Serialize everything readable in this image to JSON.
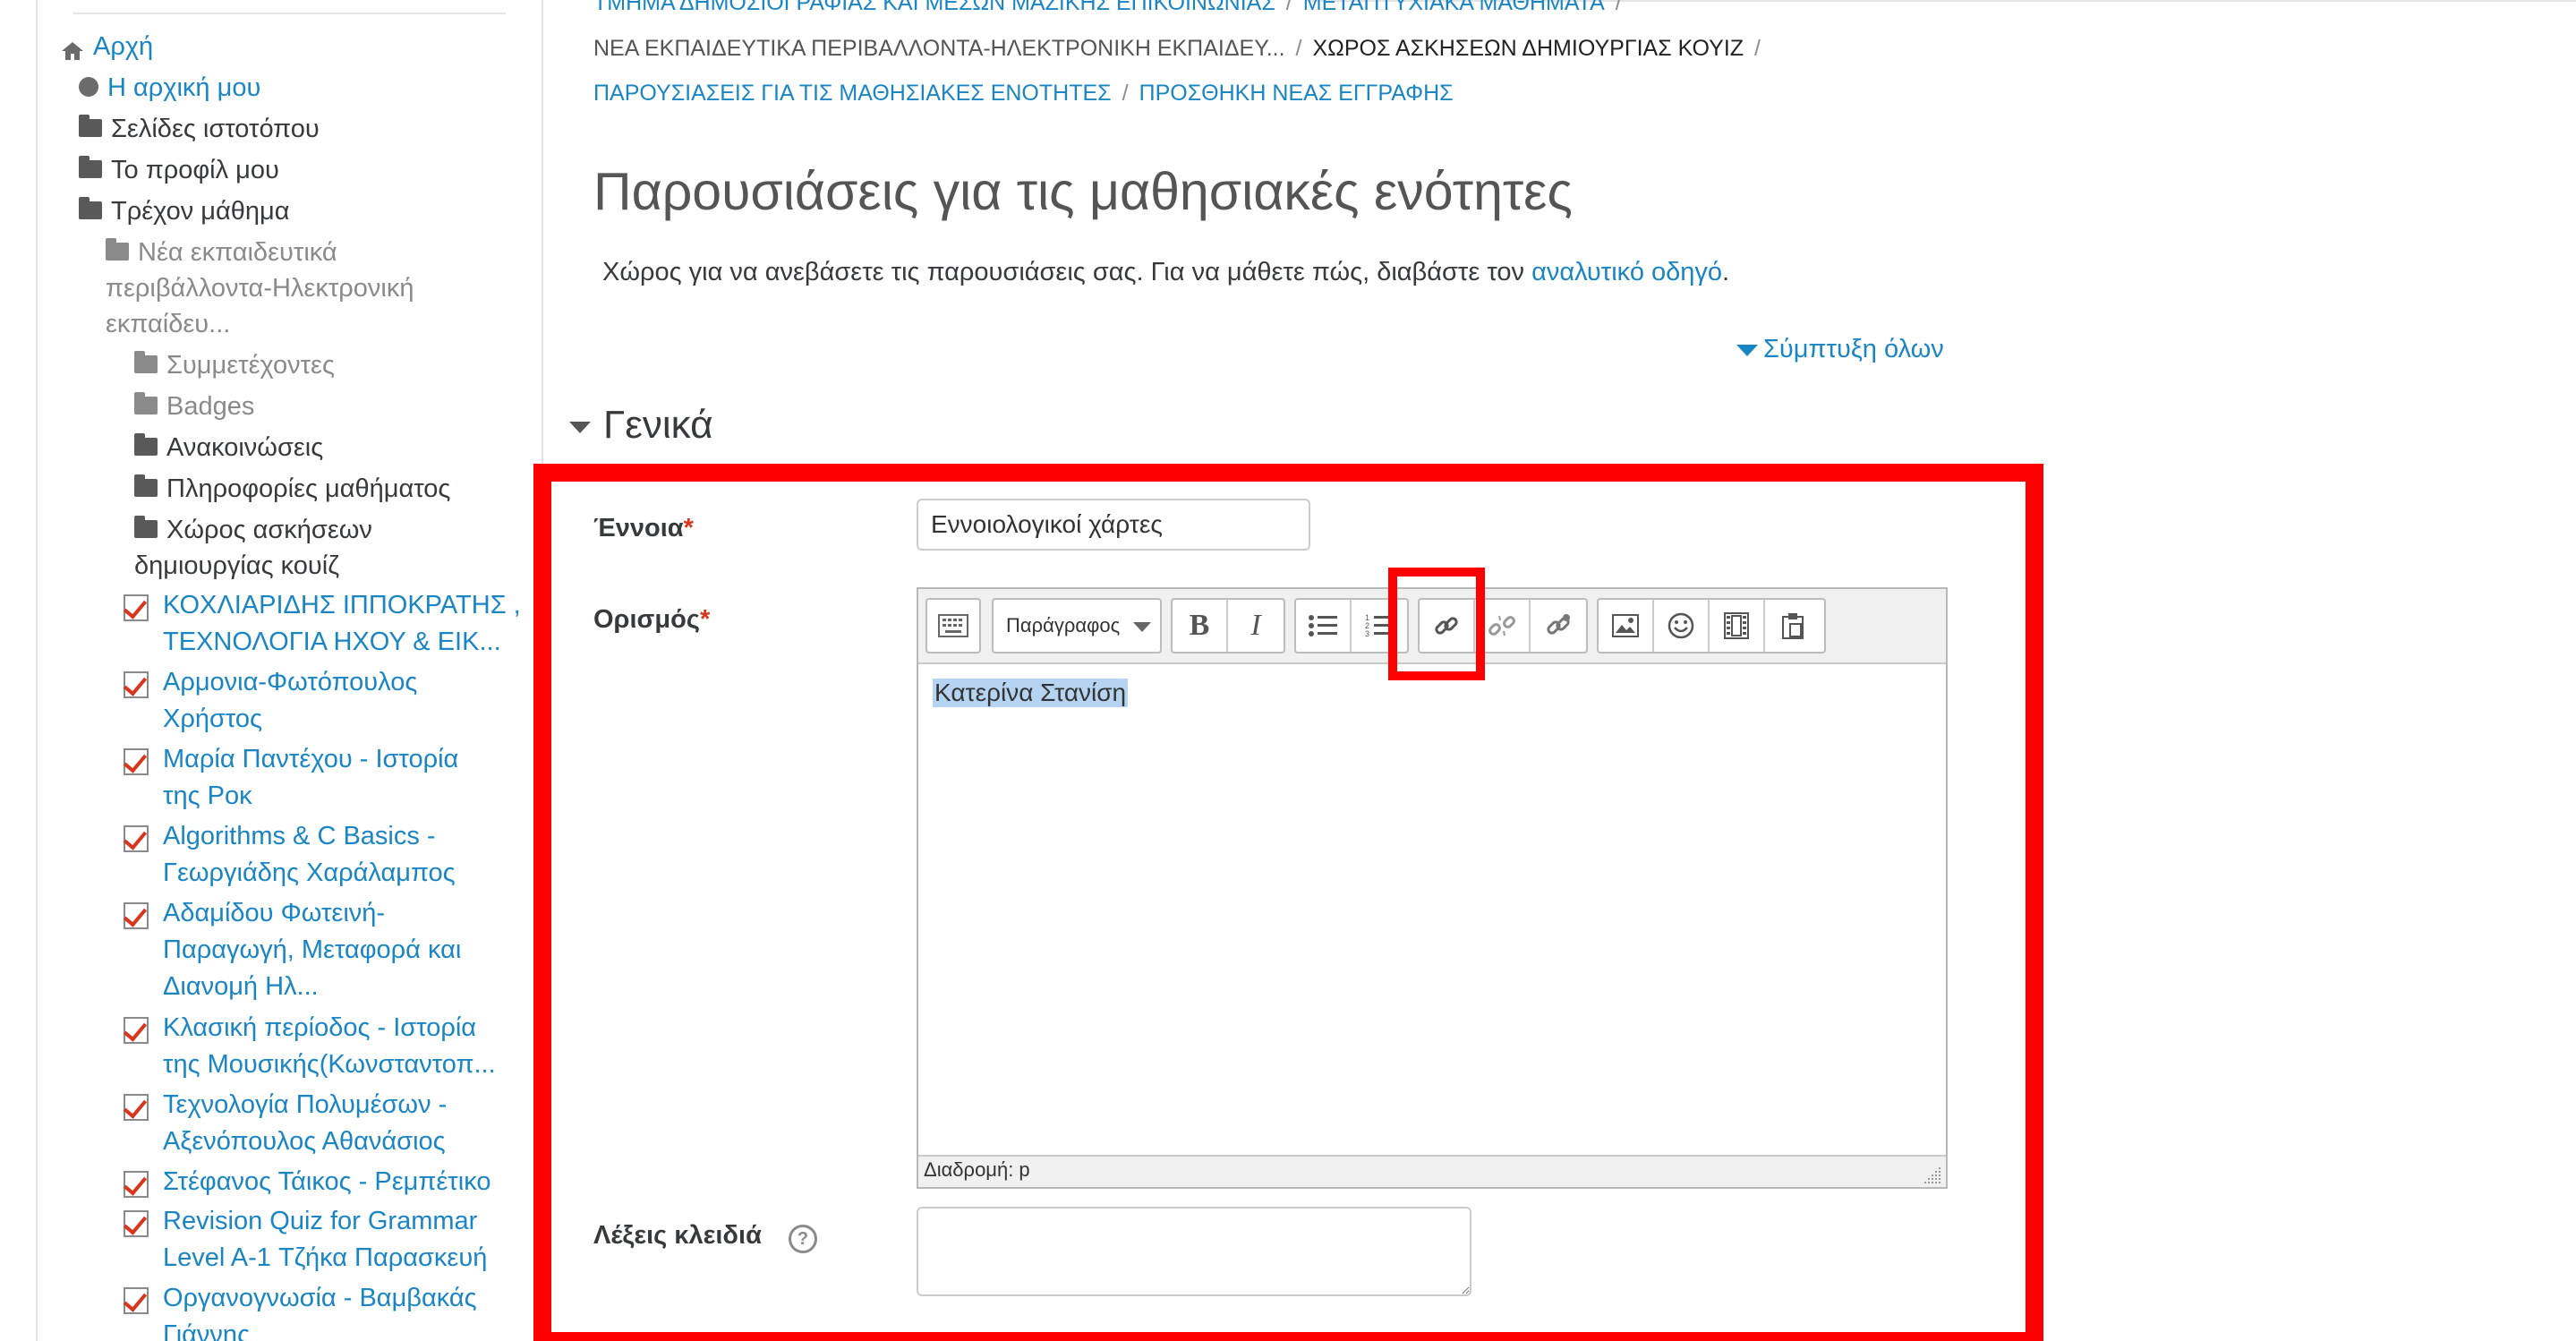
{
  "sidebar": {
    "nav": [
      {
        "label": "Αρχή",
        "icon": "home-icon",
        "link": true
      },
      {
        "label": "Η αρχική μου",
        "icon": "circle-icon",
        "link": true
      },
      {
        "label": "Σελίδες ιστοτόπου",
        "icon": "folder-icon",
        "link": false
      },
      {
        "label": "Το προφίλ μου",
        "icon": "folder-icon",
        "link": false
      },
      {
        "label": "Τρέχον μάθημα",
        "icon": "folder-icon",
        "link": false
      }
    ],
    "course": {
      "line1": "Νέα εκπαιδευτικά",
      "line2": "περιβάλλοντα-Ηλεκτρονική",
      "line3": "εκπαίδευ..."
    },
    "course_items": [
      "Συμμετέχοντες",
      "Badges",
      "Ανακοινώσεις",
      "Πληροφορίες μαθήματος"
    ],
    "quiz_space": {
      "line1": "Χώρος ασκήσεων",
      "line2": "δημιουργίας κουίζ"
    },
    "quizzes": [
      {
        "line1": "ΚΟΧΛΙΑΡΙΔΗΣ ΙΠΠΟΚΡΑΤΗΣ ,",
        "line2": "ΤΕΧΝΟΛΟΓΙΑ ΗΧΟΥ & ΕΙΚ..."
      },
      {
        "line1": "Αρμονια-Φωτόπουλος",
        "line2": "Χρήστος"
      },
      {
        "line1": "Μαρία Παντέχου - Ιστορία",
        "line2": "της Ροκ"
      },
      {
        "line1": "Algorithms & C Basics -",
        "line2": "Γεωργιάδης Χαράλαμπος"
      },
      {
        "line1": "Αδαμίδου Φωτεινή-",
        "line2": "Παραγωγή, Μεταφορά και",
        "line3": "Διανομή Ηλ..."
      },
      {
        "line1": "Κλασική περίοδος - Ιστορία",
        "line2": "της Μουσικής(Κωνσταντοπ..."
      },
      {
        "line1": "Τεχνολογία Πολυμέσων -",
        "line2": "Αξενόπουλος Αθανάσιος"
      },
      {
        "line1": "Στέφανος Τάικος - Ρεμπέτικο"
      },
      {
        "line1": "Revision Quiz for Grammar",
        "line2": "Level A-1 Τζήκα Παρασκευή"
      },
      {
        "line1": "Οργανογνωσία - Βαμβακάς",
        "line2": "Γιάννης"
      }
    ]
  },
  "breadcrumb": {
    "row1": [
      "ΤΜΗΜΑ ΔΗΜΟΣΙΟΓΡΑΦΙΑΣ ΚΑΙ ΜΕΣΩΝ ΜΑΖΙΚΗΣ ΕΠΙΚΟΙΝΩΝΙΑΣ",
      "ΜΕΤΑΠΤΥΧΙΑΚΑ ΜΑΘΗΜΑΤΑ"
    ],
    "row2": [
      "ΝΕΑ ΕΚΠΑΙΔΕΥΤΙΚΑ ΠΕΡΙΒΑΛΛΟΝΤΑ-ΗΛΕΚΤΡΟΝΙΚΗ ΕΚΠΑΙΔΕΥ...",
      "ΧΩΡΟΣ ΑΣΚΗΣΕΩΝ ΔΗΜΙΟΥΡΓΙΑΣ ΚΟΥΙΖ"
    ],
    "row3": [
      "ΠΑΡΟΥΣΙΑΣΕΙΣ ΓΙΑ ΤΙΣ ΜΑΘΗΣΙΑΚΕΣ ΕΝΟΤΗΤΕΣ",
      "ΠΡΟΣΘΗΚΗ ΝΕΑΣ ΕΓΓΡΑΦΗΣ"
    ],
    "separator": "/"
  },
  "page": {
    "title": "Παρουσιάσεις για τις μαθησιακές ενότητες",
    "intro_text": "Χώρος για να ανεβάσετε τις παρουσιάσεις σας. Για να μάθετε πώς, διαβάστε τον ",
    "intro_link": "αναλυτικό οδηγό",
    "intro_end": ".",
    "collapse_all": "Σύμπτυξη όλων",
    "section_title": "Γενικά"
  },
  "form": {
    "concept_label": "Έννοια",
    "concept_value": "Εννοιολογικοί χάρτες",
    "definition_label": "Ορισμός",
    "required_mark": "*",
    "editor": {
      "paragraph_select": "Παράγραφος",
      "content": "Κατερίνα Στανίση",
      "path_label": "Διαδρομή: p",
      "buttons": [
        "toolbar-toggle-icon",
        "bold-icon",
        "italic-icon",
        "bullet-list-icon",
        "numbered-list-icon",
        "link-icon",
        "unlink-icon",
        "autolink-icon",
        "image-icon",
        "emoticon-icon",
        "media-icon",
        "manage-files-icon"
      ]
    },
    "keywords_label": "Λέξεις κλειδιά",
    "help_glyph": "?"
  },
  "colors": {
    "link": "#1a85c4",
    "highlight_box": "#ff0000",
    "required": "#d9341c"
  }
}
